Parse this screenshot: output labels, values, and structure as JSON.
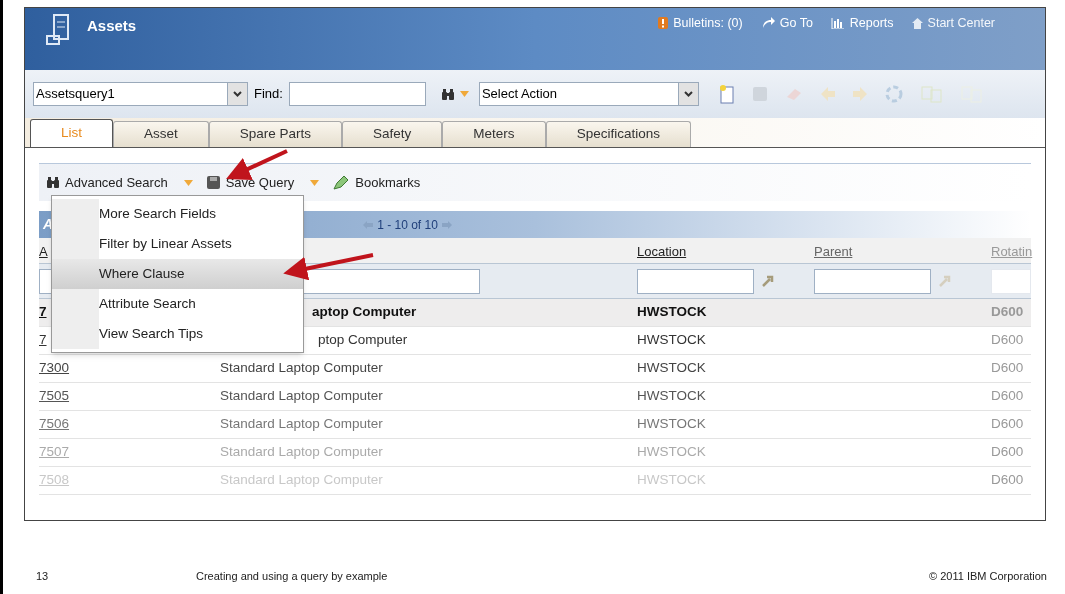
{
  "app": {
    "title": "Assets",
    "links": [
      {
        "label": "Bulletins: (0)",
        "kind": "bulletins"
      },
      {
        "label": "Go To",
        "kind": "goto"
      },
      {
        "label": "Reports",
        "kind": "reports"
      },
      {
        "label": "Start Center",
        "kind": "home"
      }
    ]
  },
  "toolbar": {
    "query": "Assetsquery1",
    "find_label": "Find:",
    "action": "Select Action"
  },
  "tabs": [
    {
      "label": "List",
      "selected": true
    },
    {
      "label": "Asset",
      "selected": false
    },
    {
      "label": "Spare Parts",
      "selected": false
    },
    {
      "label": "Safety",
      "selected": false
    },
    {
      "label": "Meters",
      "selected": false
    },
    {
      "label": "Specifications",
      "selected": false
    }
  ],
  "search_bar": [
    {
      "label": "Advanced Search",
      "kind": "search"
    },
    {
      "label": "Save Query",
      "kind": "save"
    },
    {
      "label": "Bookmarks",
      "kind": "bookmark"
    }
  ],
  "menu": {
    "open": true,
    "items": [
      {
        "label": "More Search Fields",
        "selected": false
      },
      {
        "label": "Filter by Linear Assets",
        "selected": false
      },
      {
        "label": "Where Clause",
        "selected": true
      },
      {
        "label": "Attribute Search",
        "selected": false
      },
      {
        "label": "View Search Tips",
        "selected": false
      }
    ]
  },
  "table": {
    "title": "A",
    "pager": "1 - 10 of 10",
    "columns": [
      {
        "label": "A",
        "lookup": false
      },
      {
        "lookup": false
      },
      {
        "label": "Location",
        "lookup": true
      },
      {
        "label": "Parent",
        "lookup": true
      },
      {
        "label": "Rotatin",
        "lookup": false
      }
    ],
    "rows": [
      {
        "asset": "7",
        "description": "aptop Computer",
        "location": "HWSTOCK",
        "rotating": "D600",
        "selected": true
      },
      {
        "asset": "7",
        "description": "ptop Computer",
        "location": "HWSTOCK",
        "rotating": "D600",
        "selected": false
      },
      {
        "asset": "7300",
        "description": "Standard Laptop Computer",
        "location": "HWSTOCK",
        "rotating": "D600",
        "selected": false
      },
      {
        "asset": "7505",
        "description": "Standard Laptop Computer",
        "location": "HWSTOCK",
        "rotating": "D600",
        "selected": false
      },
      {
        "asset": "7506",
        "description": "Standard Laptop Computer",
        "location": "HWSTOCK",
        "rotating": "D600",
        "selected": false
      },
      {
        "asset": "7507",
        "description": "Standard Laptop Computer",
        "location": "HWSTOCK",
        "rotating": "D600",
        "selected": false
      },
      {
        "asset": "7508",
        "description": "Standard Laptop Computer",
        "location": "HWSTOCK",
        "rotating": "D600",
        "selected": false
      }
    ]
  },
  "footer": {
    "page": "13",
    "title": "Creating and using a query by example",
    "copyright": "© 2011 IBM Corporation"
  }
}
